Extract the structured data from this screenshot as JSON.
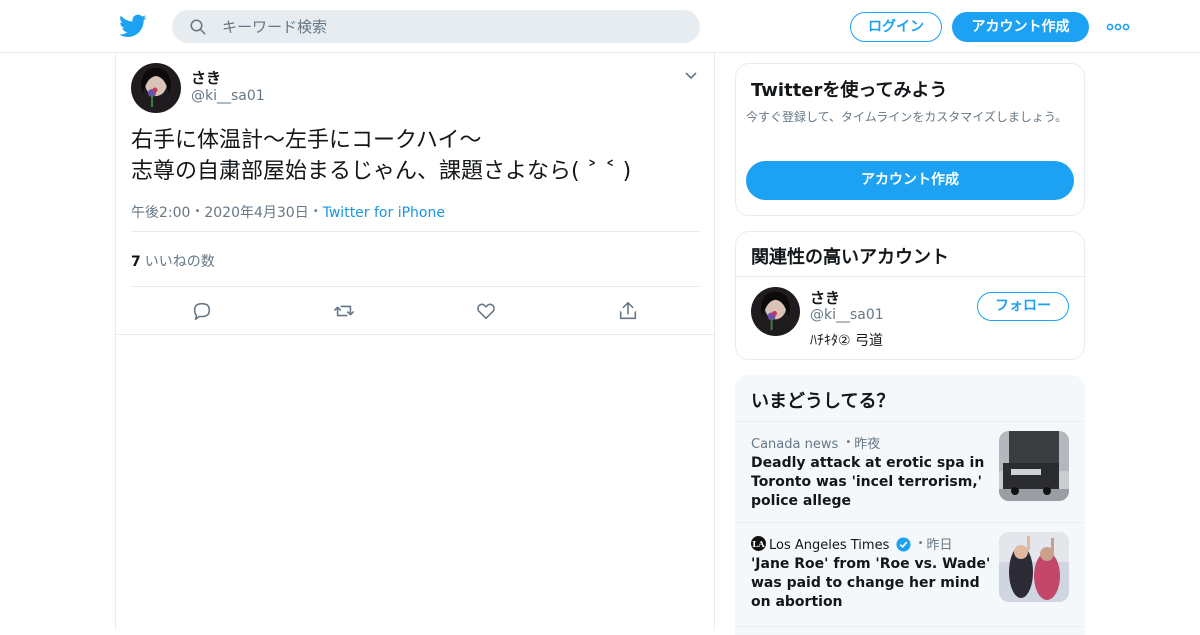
{
  "header": {
    "search_placeholder": "キーワード検索",
    "login_label": "ログイン",
    "signup_label": "アカウント作成",
    "brand_color": "#1da1f2"
  },
  "tweet": {
    "name": "さき",
    "handle": "@ki__sa01",
    "text_line1": "右手に体温計〜左手にコークハイ〜",
    "text_line2": "志尊の自粛部屋始まるじゃん、課題さよなら( ˃ ˂ )",
    "time": "午後2:00",
    "date": "2020年4月30日",
    "source": "Twitter for iPhone",
    "likes_count": "7",
    "likes_label": "いいねの数"
  },
  "signup_card": {
    "title": "Twitterを使ってみよう",
    "description": "今すぐ登録して、タイムラインをカスタマイズしましょう。",
    "button_label": "アカウント作成"
  },
  "related": {
    "title": "関連性の高いアカウント",
    "name": "さき",
    "handle": "@ki__sa01",
    "bio": "ﾊﾁｷﾀ② 弓道",
    "follow_label": "フォロー"
  },
  "trends": {
    "title": "いまどうしてる？",
    "items": [
      {
        "source": "Canada news",
        "time": "昨夜",
        "headline": "Deadly attack at erotic spa in Toronto was 'incel terrorism,' police allege"
      },
      {
        "source": "Los Angeles Times",
        "time": "昨日",
        "headline": "'Jane Roe' from 'Roe vs. Wade' was paid to change her mind on abortion"
      }
    ]
  }
}
